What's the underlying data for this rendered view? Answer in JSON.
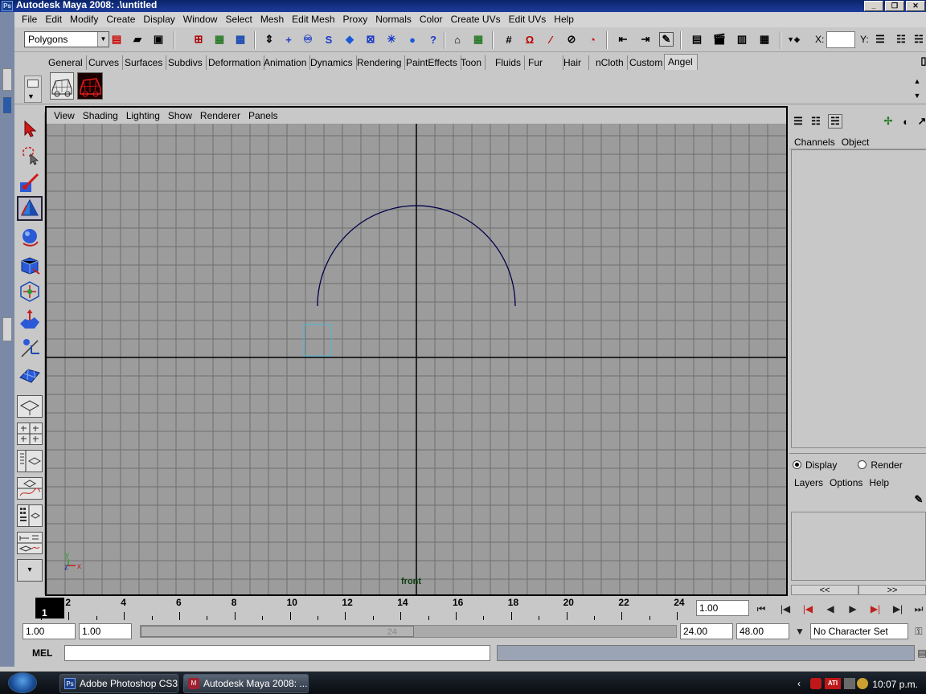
{
  "window": {
    "title": "Autodesk Maya 2008: .\\untitled",
    "minimize": "_",
    "restore": "❐",
    "close": "✕"
  },
  "menubar": [
    "File",
    "Edit",
    "Modify",
    "Create",
    "Display",
    "Window",
    "Select",
    "Mesh",
    "Edit Mesh",
    "Proxy",
    "Normals",
    "Color",
    "Create UVs",
    "Edit UVs",
    "Help"
  ],
  "statusline": {
    "mode": "Polygons",
    "x_label": "X:",
    "y_label": "Y:"
  },
  "shelf": {
    "tabs": [
      "General",
      "Curves",
      "Surfaces",
      "Subdivs",
      "Deformation",
      "Animation",
      "Dynamics",
      "Rendering",
      "PaintEffects",
      "Toon",
      "Fluids",
      "Fur",
      "Hair",
      "nCloth",
      "Custom",
      "Angel"
    ],
    "active_tab": "Angel"
  },
  "panel": {
    "menu": [
      "View",
      "Shading",
      "Lighting",
      "Show",
      "Renderer",
      "Panels"
    ],
    "camera": "front",
    "axis_x": "x",
    "axis_y": "y",
    "axis_z": "z"
  },
  "channelbox": {
    "menu": [
      "Channels",
      "Object"
    ]
  },
  "layereditor": {
    "display_label": "Display",
    "render_label": "Render",
    "display_checked": true,
    "menu": [
      "Layers",
      "Options",
      "Help"
    ],
    "scroll_left": "<<",
    "scroll_right": ">>"
  },
  "timeline": {
    "current_frame": "1",
    "tick_labels": [
      "2",
      "4",
      "6",
      "8",
      "10",
      "12",
      "14",
      "16",
      "18",
      "20",
      "22",
      "24"
    ],
    "current_time_field": "1.00"
  },
  "range": {
    "start_time": "1.00",
    "playback_start": "1.00",
    "handle_label": "24",
    "playback_end": "24.00",
    "end_time": "48.00",
    "character_set": "No Character Set"
  },
  "cmdline": {
    "label": "MEL"
  },
  "taskbar": {
    "tasks": [
      {
        "label": "Adobe Photoshop CS3...",
        "icon": "Ps"
      },
      {
        "label": "Autodesk Maya 2008: ...",
        "icon": "M"
      }
    ],
    "clock": "10:07 p.m.",
    "tray_badge": "ATI"
  }
}
